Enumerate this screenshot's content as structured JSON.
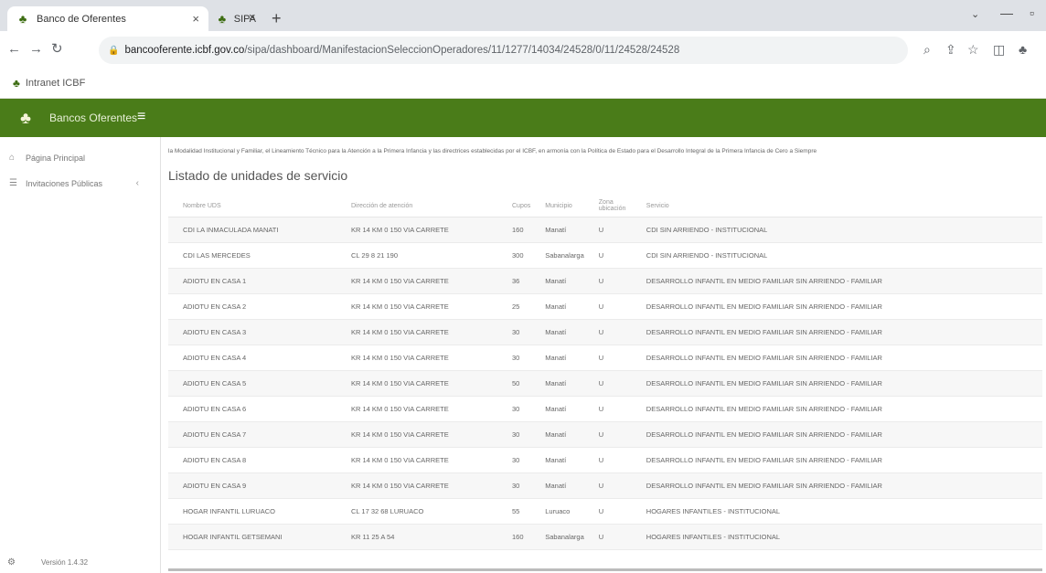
{
  "browser": {
    "tabs": [
      {
        "title": "Banco de Oferentes",
        "icon": "icbf-icon",
        "active": true
      },
      {
        "title": "SIPA",
        "icon": "icbf-icon",
        "active": false
      }
    ],
    "url_host": "bancooferente.icbf.gov.co",
    "url_path": "/sipa/dashboard/ManifestacionSeleccionOperadores/11/1277/14034/24528/0/11/24528/24528",
    "bookmark": "Intranet ICBF"
  },
  "app": {
    "title": "Bancos Oferentes",
    "header_color": "#4a7c19"
  },
  "sidebar": {
    "items": [
      {
        "label": "Página Principal",
        "icon": "home-icon"
      },
      {
        "label": "Invitaciones Públicas",
        "icon": "list-icon"
      }
    ],
    "version": "Versión 1.4.32"
  },
  "main": {
    "intro": "la Modalidad Institucional y Familiar, el Lineamiento Técnico para la Atención a la Primera Infancia y las directrices establecidas por el ICBF, en armonía con la Política de Estado para el Desarrollo Integral de la Primera Infancia de Cero a Siempre",
    "title": "Listado de unidades de servicio",
    "columns": [
      "Nombre UDS",
      "Dirección de atención",
      "Cupos",
      "Municipio",
      "Zona ubicación",
      "Servicio"
    ],
    "rows": [
      [
        "CDI LA INMACULADA MANATI",
        "KR 14 KM 0 150 VIA CARRETE",
        "160",
        "Manatí",
        "U",
        "CDI SIN ARRIENDO - INSTITUCIONAL"
      ],
      [
        "CDI LAS MERCEDES",
        "CL 29 8 21 190",
        "300",
        "Sabanalarga",
        "U",
        "CDI SIN ARRIENDO - INSTITUCIONAL"
      ],
      [
        "ADIOTU EN CASA 1",
        "KR 14 KM 0 150 VIA CARRETE",
        "36",
        "Manatí",
        "U",
        "DESARROLLO INFANTIL EN MEDIO FAMILIAR SIN ARRIENDO - FAMILIAR"
      ],
      [
        "ADIOTU EN CASA 2",
        "KR 14 KM 0 150 VIA CARRETE",
        "25",
        "Manatí",
        "U",
        "DESARROLLO INFANTIL EN MEDIO FAMILIAR SIN ARRIENDO - FAMILIAR"
      ],
      [
        "ADIOTU EN CASA 3",
        "KR 14 KM 0 150 VIA CARRETE",
        "30",
        "Manatí",
        "U",
        "DESARROLLO INFANTIL EN MEDIO FAMILIAR SIN ARRIENDO - FAMILIAR"
      ],
      [
        "ADIOTU EN CASA 4",
        "KR 14 KM 0 150 VIA CARRETE",
        "30",
        "Manatí",
        "U",
        "DESARROLLO INFANTIL EN MEDIO FAMILIAR SIN ARRIENDO - FAMILIAR"
      ],
      [
        "ADIOTU EN CASA 5",
        "KR 14 KM 0 150 VIA CARRETE",
        "50",
        "Manatí",
        "U",
        "DESARROLLO INFANTIL EN MEDIO FAMILIAR SIN ARRIENDO - FAMILIAR"
      ],
      [
        "ADIOTU EN CASA 6",
        "KR 14 KM 0 150 VIA CARRETE",
        "30",
        "Manatí",
        "U",
        "DESARROLLO INFANTIL EN MEDIO FAMILIAR SIN ARRIENDO - FAMILIAR"
      ],
      [
        "ADIOTU EN CASA 7",
        "KR 14 KM 0 150 VIA CARRETE",
        "30",
        "Manatí",
        "U",
        "DESARROLLO INFANTIL EN MEDIO FAMILIAR SIN ARRIENDO - FAMILIAR"
      ],
      [
        "ADIOTU EN CASA 8",
        "KR 14 KM 0 150 VIA CARRETE",
        "30",
        "Manatí",
        "U",
        "DESARROLLO INFANTIL EN MEDIO FAMILIAR SIN ARRIENDO - FAMILIAR"
      ],
      [
        "ADIOTU EN CASA 9",
        "KR 14 KM 0 150 VIA CARRETE",
        "30",
        "Manatí",
        "U",
        "DESARROLLO INFANTIL EN MEDIO FAMILIAR SIN ARRIENDO - FAMILIAR"
      ],
      [
        "HOGAR INFANTIL LURUACO",
        "CL 17 32 68 LURUACO",
        "55",
        "Luruaco",
        "U",
        "HOGARES INFANTILES - INSTITUCIONAL"
      ],
      [
        "HOGAR INFANTIL GETSEMANI",
        "KR 11 25 A 54",
        "160",
        "Sabanalarga",
        "U",
        "HOGARES INFANTILES - INSTITUCIONAL"
      ]
    ]
  }
}
